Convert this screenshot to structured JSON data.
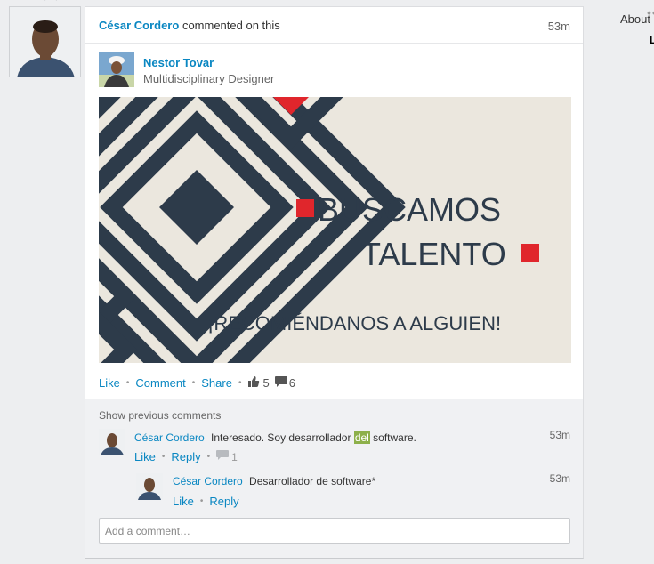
{
  "activity": {
    "actor_name": "César Cordero",
    "action_text": "commented on this",
    "time": "53m"
  },
  "post": {
    "author_name": "Nestor Tovar",
    "author_title": "Multidisciplinary Designer",
    "image": {
      "line1": "BUSCAMOS",
      "line2": "TALENTO",
      "tagline": "¡RECOMIÉNDANOS A ALGUIEN!"
    },
    "actions": {
      "like": "Like",
      "comment": "Comment",
      "share": "Share",
      "like_count": "5",
      "comment_count": "6"
    }
  },
  "comments": {
    "show_previous": "Show previous comments",
    "items": [
      {
        "name": "César Cordero",
        "text_before": "Interesado. Soy desarrollador ",
        "text_highlight": "del",
        "text_after": " software.",
        "time": "53m",
        "like": "Like",
        "reply": "Reply",
        "reply_count": "1"
      },
      {
        "name": "César Cordero",
        "text": "Desarrollador de software*",
        "time": "53m",
        "like": "Like",
        "reply": "Reply"
      }
    ],
    "input_placeholder": "Add a comment…"
  },
  "sidebar": {
    "about": "About",
    "edge_letter": "L"
  },
  "colors": {
    "link": "#0a87c2",
    "accent_red": "#e0262c",
    "pattern_navy": "#2d3b4a",
    "image_bg": "#ebe7de"
  }
}
